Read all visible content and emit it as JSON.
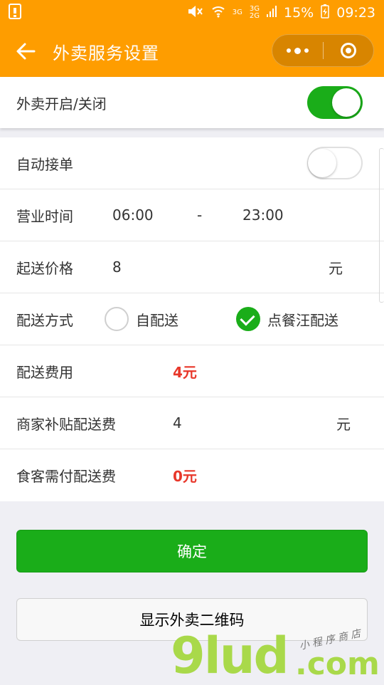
{
  "status_bar": {
    "network_1": "3G",
    "network_2": "3G",
    "network_3": "2G",
    "battery_percent": "15%",
    "time": "09:23"
  },
  "header": {
    "title": "外卖服务设置"
  },
  "delivery_toggle": {
    "label": "外卖开启/关闭",
    "on": true
  },
  "settings": {
    "auto_accept": {
      "label": "自动接单",
      "on": false
    },
    "hours": {
      "label": "营业时间",
      "start": "06:00",
      "separator": "-",
      "end": "23:00"
    },
    "min_price": {
      "label": "起送价格",
      "value": "8",
      "unit": "元"
    },
    "delivery_method": {
      "label": "配送方式",
      "options": [
        {
          "label": "自配送",
          "checked": false
        },
        {
          "label": "点餐汪配送",
          "checked": true
        }
      ]
    },
    "delivery_fee": {
      "label": "配送费用",
      "value": "4元"
    },
    "merchant_subsidy": {
      "label": "商家补贴配送费",
      "value": "4",
      "unit": "元"
    },
    "customer_fee": {
      "label": "食客需付配送费",
      "value": "0元"
    }
  },
  "buttons": {
    "confirm": "确定",
    "show_qr": "显示外卖二维码"
  },
  "watermark": {
    "brand": "9lud",
    "suffix": ".com",
    "tagline": "小 程 序 商 店"
  },
  "colors": {
    "header": "#fe9d00",
    "green": "#1aad19",
    "red": "#e8372a"
  }
}
